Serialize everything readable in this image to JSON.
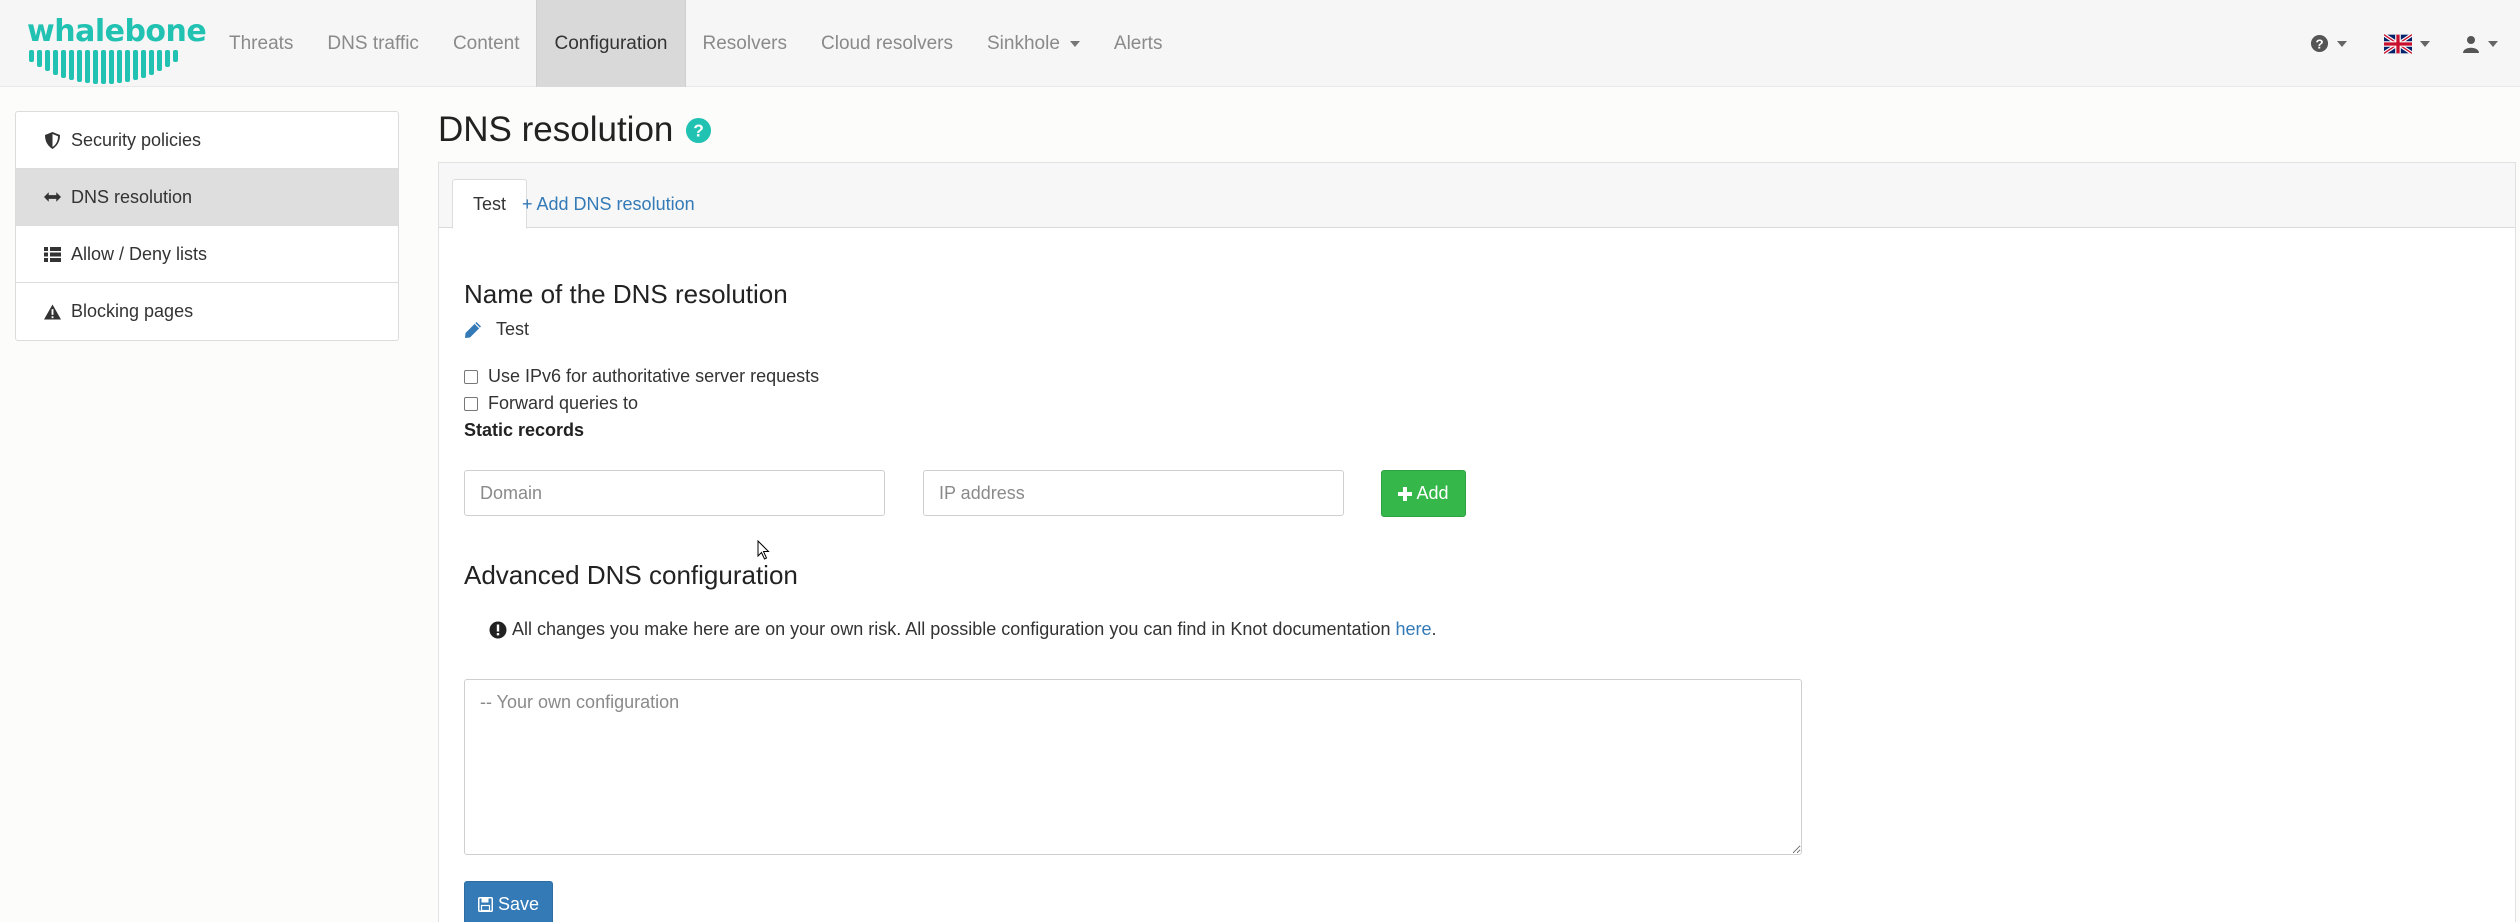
{
  "brand": {
    "name": "whalebone",
    "color": "#21c2b2"
  },
  "nav": {
    "items": [
      {
        "label": "Threats"
      },
      {
        "label": "DNS traffic"
      },
      {
        "label": "Content"
      },
      {
        "label": "Configuration",
        "active": true
      },
      {
        "label": "Resolvers"
      },
      {
        "label": "Cloud resolvers"
      },
      {
        "label": "Sinkhole",
        "dropdown": true
      },
      {
        "label": "Alerts"
      }
    ],
    "right": {
      "help_icon": "question-circle-icon",
      "language_icon": "uk-flag-icon",
      "user_icon": "user-icon"
    }
  },
  "sidebar": {
    "items": [
      {
        "label": "Security policies",
        "icon": "shield-icon"
      },
      {
        "label": "DNS resolution",
        "icon": "arrows-horizontal-icon",
        "active": true
      },
      {
        "label": "Allow / Deny lists",
        "icon": "list-icon"
      },
      {
        "label": "Blocking pages",
        "icon": "warning-icon"
      }
    ]
  },
  "main": {
    "title": "DNS resolution",
    "tabs": [
      {
        "label": "Test",
        "active": true
      },
      {
        "label": "+ Add DNS resolution"
      }
    ],
    "name_heading": "Name of the DNS resolution",
    "name_value": "Test",
    "ipv6_label": "Use IPv6 for authoritative server requests",
    "ipv6_checked": false,
    "forward_label": "Forward queries to",
    "forward_checked": false,
    "static_records_label": "Static records",
    "domain_placeholder": "Domain",
    "ip_placeholder": "IP address",
    "add_label": "Add",
    "advanced_heading": "Advanced DNS configuration",
    "warning_text": "All changes you make here are on your own risk. All possible configuration you can find in Knot documentation ",
    "warning_link": "here",
    "warning_end": ".",
    "config_placeholder": "-- Your own configuration",
    "save_label": "Save"
  },
  "colors": {
    "accent": "#337ab7",
    "success": "#35b74a",
    "teal": "#21c2b2"
  }
}
